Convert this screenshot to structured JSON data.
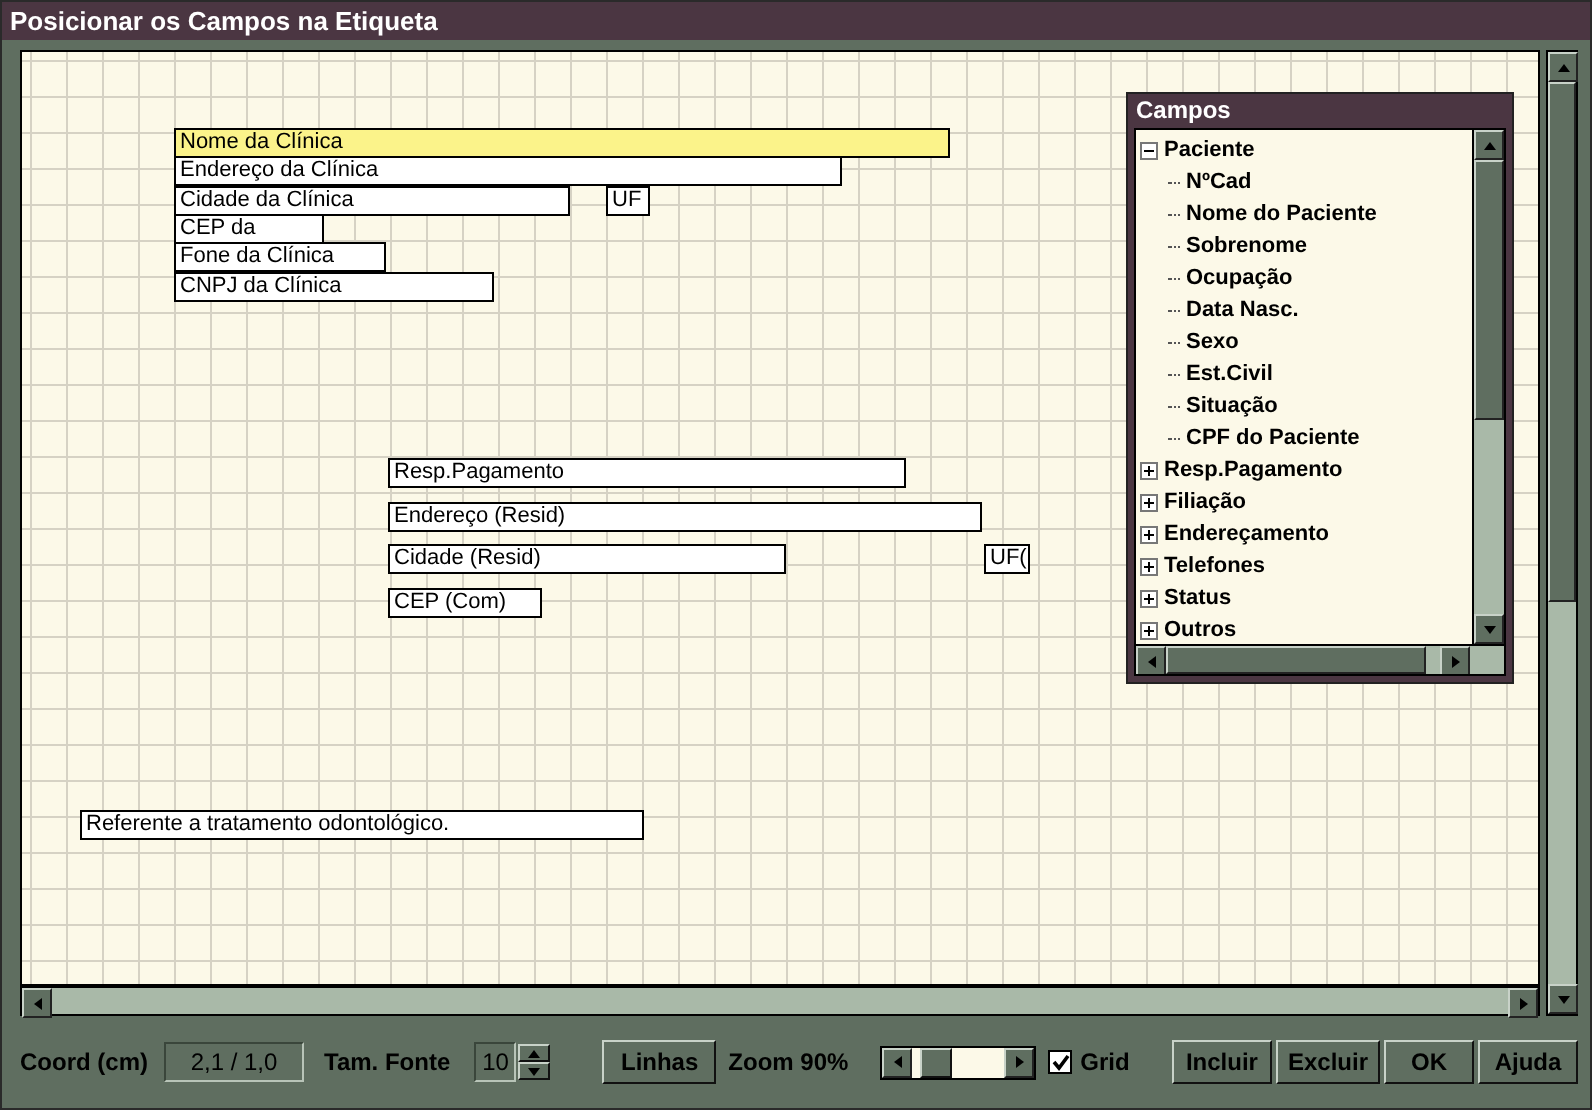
{
  "window": {
    "title": "Posicionar os Campos na Etiqueta"
  },
  "canvas": {
    "grid": true,
    "fields": [
      {
        "text": "Nome da Clínica",
        "selected": true
      },
      {
        "text": "Endereço da Clínica",
        "selected": false
      },
      {
        "text": "Cidade da Clínica",
        "selected": false
      },
      {
        "text": "UF",
        "selected": false
      },
      {
        "text": "CEP da",
        "selected": false
      },
      {
        "text": "Fone da Clínica",
        "selected": false
      },
      {
        "text": "CNPJ da Clínica",
        "selected": false
      },
      {
        "text": "Resp.Pagamento",
        "selected": false
      },
      {
        "text": "Endereço (Resid)",
        "selected": false
      },
      {
        "text": "Cidade (Resid)",
        "selected": false
      },
      {
        "text": "UF(",
        "selected": false
      },
      {
        "text": "CEP (Com)",
        "selected": false
      },
      {
        "text": "Referente a tratamento odontológico.",
        "selected": false
      }
    ]
  },
  "fields_panel": {
    "title": "Campos",
    "tree": [
      {
        "label": "Paciente",
        "expanded": true,
        "children": [
          {
            "label": "NºCad"
          },
          {
            "label": "Nome do Paciente"
          },
          {
            "label": "Sobrenome"
          },
          {
            "label": "Ocupação"
          },
          {
            "label": "Data Nasc."
          },
          {
            "label": "Sexo"
          },
          {
            "label": "Est.Civil"
          },
          {
            "label": "Situação"
          },
          {
            "label": "CPF do Paciente"
          }
        ]
      },
      {
        "label": "Resp.Pagamento",
        "expanded": false
      },
      {
        "label": "Filiação",
        "expanded": false
      },
      {
        "label": "Endereçamento",
        "expanded": false
      },
      {
        "label": "Telefones",
        "expanded": false
      },
      {
        "label": "Status",
        "expanded": false
      },
      {
        "label": "Outros",
        "expanded": false
      }
    ]
  },
  "toolbar": {
    "coord_label": "Coord (cm)",
    "coord_value": "2,1 / 1,0",
    "font_size_label": "Tam. Fonte",
    "font_size": "10",
    "lines_button": "Linhas",
    "zoom_label": "Zoom 90%",
    "zoom_slider": {
      "level": 0.12
    },
    "grid_checkbox": {
      "label": "Grid",
      "checked": true
    },
    "buttons": [
      "Incluir",
      "Excluir",
      "OK",
      "Ajuda"
    ]
  }
}
